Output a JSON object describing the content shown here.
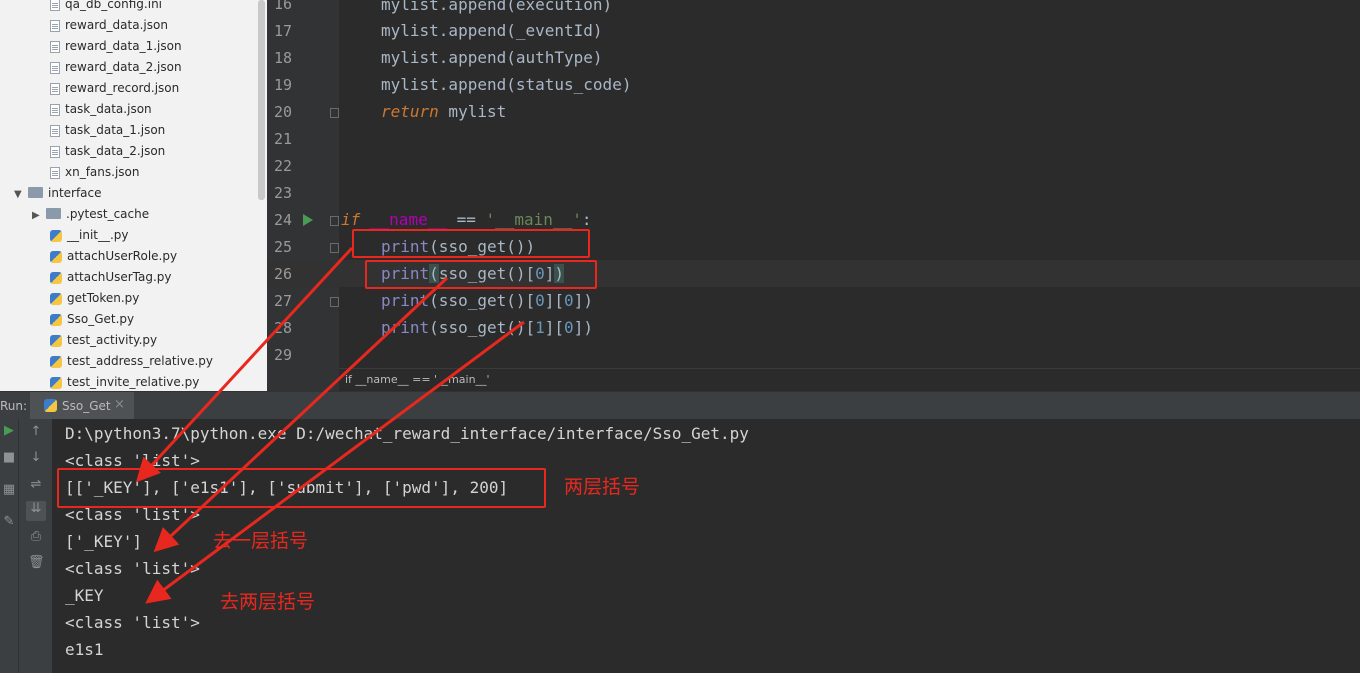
{
  "tree": {
    "items": [
      {
        "label": "qa_db_config.ini",
        "icon": "file-icon"
      },
      {
        "label": "reward_data.json",
        "icon": "file-icon"
      },
      {
        "label": "reward_data_1.json",
        "icon": "file-icon"
      },
      {
        "label": "reward_data_2.json",
        "icon": "file-icon"
      },
      {
        "label": "reward_record.json",
        "icon": "file-icon"
      },
      {
        "label": "task_data.json",
        "icon": "file-icon"
      },
      {
        "label": "task_data_1.json",
        "icon": "file-icon"
      },
      {
        "label": "task_data_2.json",
        "icon": "file-icon"
      },
      {
        "label": "xn_fans.json",
        "icon": "file-icon"
      },
      {
        "label": "interface",
        "icon": "folder-icon",
        "expanded": true
      },
      {
        "label": ".pytest_cache",
        "icon": "folder-icon",
        "expanded": false
      },
      {
        "label": "__init__.py",
        "icon": "python-file-icon"
      },
      {
        "label": "attachUserRole.py",
        "icon": "python-file-icon"
      },
      {
        "label": "attachUserTag.py",
        "icon": "python-file-icon"
      },
      {
        "label": "getToken.py",
        "icon": "python-file-icon"
      },
      {
        "label": "Sso_Get.py",
        "icon": "python-file-icon"
      },
      {
        "label": "test_activity.py",
        "icon": "python-file-icon"
      },
      {
        "label": "test_address_relative.py",
        "icon": "python-file-icon"
      },
      {
        "label": "test_invite_relative.py",
        "icon": "python-file-icon"
      }
    ]
  },
  "editor": {
    "line_numbers": [
      "16",
      "17",
      "18",
      "19",
      "20",
      "21",
      "22",
      "23",
      "24",
      "25",
      "26",
      "27",
      "28",
      "29"
    ],
    "current_line": "26",
    "breadcrumb": "if __name__ == '__main__'"
  },
  "run": {
    "label": "Run:",
    "tab_name": "Sso_Get",
    "output": [
      "D:\\python3.7\\python.exe D:/wechat_reward_interface/interface/Sso_Get.py",
      "<class 'list'>",
      "[['_KEY'], ['e1s1'], ['submit'], ['pwd'], 200]",
      "<class 'list'>",
      "['_KEY']",
      "<class 'list'>",
      "_KEY",
      "<class 'list'>",
      "e1s1"
    ]
  },
  "annotations": {
    "two_brackets": "两层括号",
    "remove_one": "去一层括号",
    "remove_two": "去两层括号",
    "color": "#e8281e"
  }
}
